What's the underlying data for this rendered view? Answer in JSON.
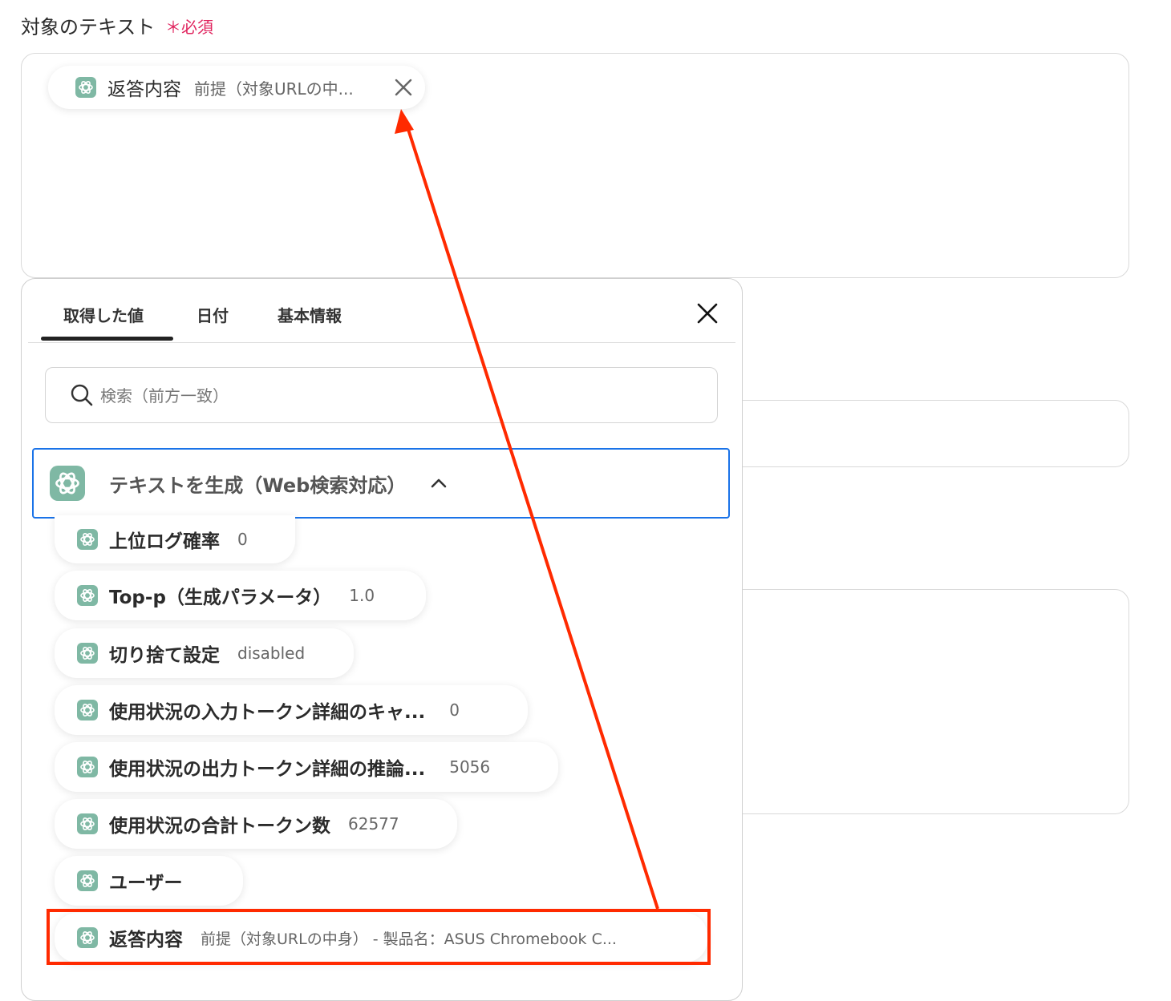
{
  "field": {
    "label": "対象のテキスト",
    "required": "＊必須"
  },
  "selected_chip": {
    "name": "返答内容",
    "value": "前提（対象URLの中..."
  },
  "panel": {
    "tabs": [
      {
        "label": "取得した値",
        "active": true
      },
      {
        "label": "日付",
        "active": false
      },
      {
        "label": "基本情報",
        "active": false
      }
    ],
    "search_placeholder": "検索（前方一致）",
    "section_title": "テキストを生成（Web検索対応）",
    "items": [
      {
        "name": "上位ログ確率",
        "value": "0"
      },
      {
        "name": "Top-p（生成パラメータ）",
        "value": "1.0"
      },
      {
        "name": "切り捨て設定",
        "value": "disabled"
      },
      {
        "name": "使用状況の入力トークン詳細のキャ...",
        "value": "0"
      },
      {
        "name": "使用状況の出力トークン詳細の推論...",
        "value": "5056"
      },
      {
        "name": "使用状況の合計トークン数",
        "value": "62577"
      },
      {
        "name": "ユーザー",
        "value": ""
      },
      {
        "name": "返答内容",
        "value": "前提（対象URLの中身） - 製品名：ASUS Chromebook C..."
      }
    ]
  },
  "colors": {
    "accent_blue": "#1a73e8",
    "annotation_red": "#ff2a00",
    "required_red": "#e0245e",
    "icon_green": "#7fb8a4"
  },
  "icons": [
    "openai-icon",
    "close-icon",
    "search-icon",
    "chevron-up-icon"
  ]
}
